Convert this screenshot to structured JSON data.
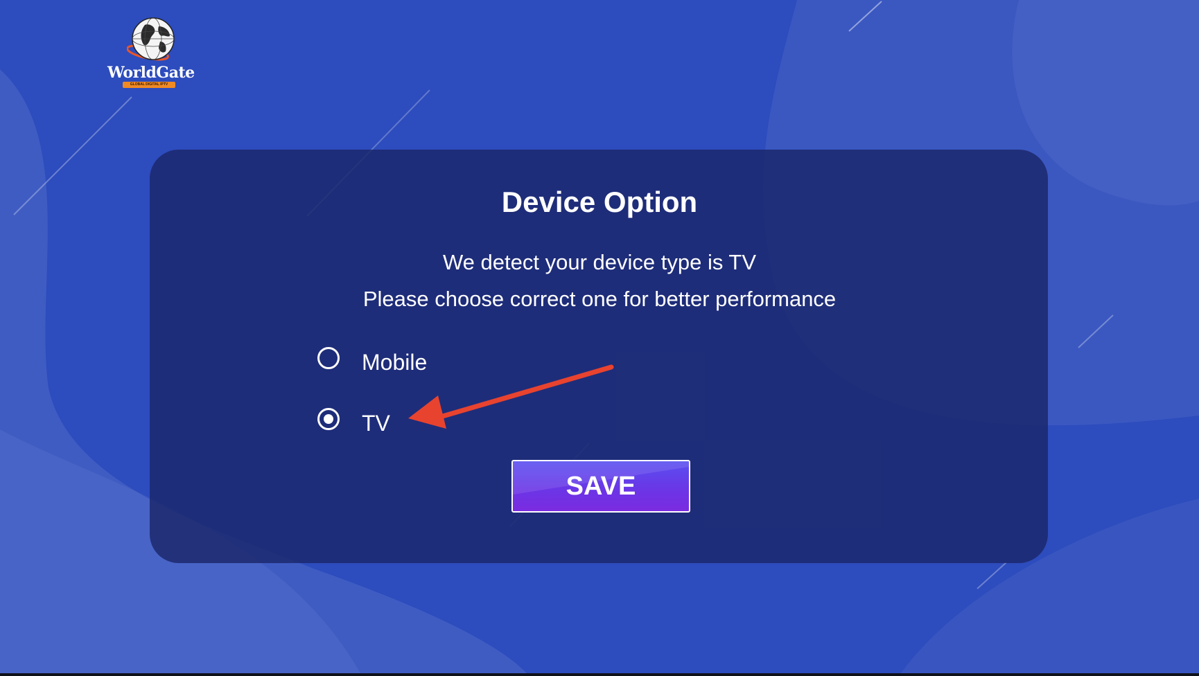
{
  "logo": {
    "name": "WorldGate",
    "tagline": "GLOBAL DIGITAL IPTV"
  },
  "dialog": {
    "title": "Device Option",
    "detect_message": "We detect your device type is TV",
    "choose_message": "Please choose correct one for better performance",
    "options": [
      {
        "label": "Mobile",
        "selected": false
      },
      {
        "label": "TV",
        "selected": true
      }
    ],
    "save_label": "SAVE"
  },
  "annotation": {
    "arrow_color": "#e8432f",
    "points_to": "TV"
  },
  "colors": {
    "background": "#2d4cbd",
    "panel": "#1c296e",
    "button_gradient_start": "#5a4ff0",
    "button_gradient_end": "#7b2be0",
    "text": "#ffffff"
  }
}
